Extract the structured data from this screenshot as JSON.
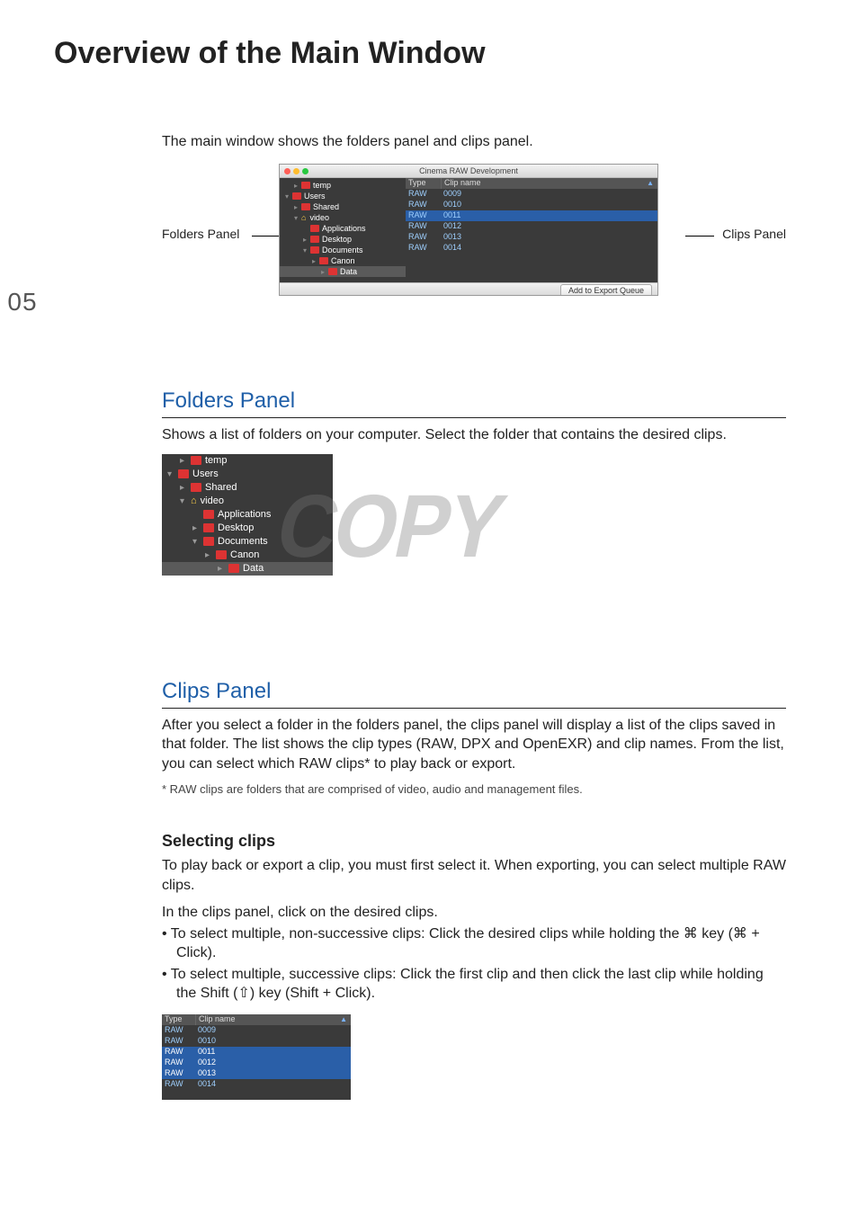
{
  "page_number": "05",
  "title": "Overview of the Main Window",
  "intro": "The main window shows the folders panel and clips panel.",
  "fig_main": {
    "left_label": "Folders Panel",
    "right_label": "Clips Panel",
    "window_title": "Cinema RAW Development",
    "export_button": "Add to Export Queue",
    "folders": [
      {
        "indent": 1,
        "arrow": "▸",
        "icon": "folder",
        "label": "temp"
      },
      {
        "indent": 0,
        "arrow": "▾",
        "icon": "folder",
        "label": "Users"
      },
      {
        "indent": 1,
        "arrow": "▸",
        "icon": "folder",
        "label": "Shared"
      },
      {
        "indent": 1,
        "arrow": "▾",
        "icon": "home",
        "label": "video"
      },
      {
        "indent": 2,
        "arrow": "",
        "icon": "folder",
        "label": "Applications"
      },
      {
        "indent": 2,
        "arrow": "▸",
        "icon": "folder",
        "label": "Desktop"
      },
      {
        "indent": 2,
        "arrow": "▾",
        "icon": "folder",
        "label": "Documents"
      },
      {
        "indent": 3,
        "arrow": "▸",
        "icon": "folder",
        "label": "Canon"
      },
      {
        "indent": 4,
        "arrow": "▸",
        "icon": "folder",
        "label": "Data",
        "selected": true
      }
    ],
    "clip_headers": {
      "type": "Type",
      "name": "Clip name"
    },
    "clips": [
      {
        "type": "RAW",
        "name": "0009"
      },
      {
        "type": "RAW",
        "name": "0010"
      },
      {
        "type": "RAW",
        "name": "0011",
        "selected": true
      },
      {
        "type": "RAW",
        "name": "0012"
      },
      {
        "type": "RAW",
        "name": "0013"
      },
      {
        "type": "RAW",
        "name": "0014"
      }
    ]
  },
  "sections": {
    "folders": {
      "heading": "Folders Panel",
      "body": "Shows a list of folders on your computer. Select the folder that contains the desired clips."
    },
    "clips": {
      "heading": "Clips Panel",
      "body": "After you select a folder in the folders panel, the clips panel will display a list of the clips saved in that folder. The list shows the clip types (RAW, DPX and OpenEXR) and clip names. From the list, you can select which RAW clips* to play back or export.",
      "footnote": "* RAW clips are folders that are comprised of video, audio and management files."
    }
  },
  "watermark": "COPY",
  "selecting": {
    "heading": "Selecting clips",
    "body": "To play back or export a clip, you must first select it. When exporting, you can select multiple RAW clips.",
    "lead": "In the clips panel, click on the desired clips.",
    "bullets": [
      "To select multiple, non-successive clips: Click the desired clips while holding the ⌘ key (⌘ + Click).",
      "To select multiple, successive clips: Click the first clip and then click the last clip while holding the Shift (⇧) key (Shift + Click)."
    ]
  },
  "fig_clips_small": {
    "headers": {
      "type": "Type",
      "name": "Clip name"
    },
    "rows": [
      {
        "type": "RAW",
        "name": "0009"
      },
      {
        "type": "RAW",
        "name": "0010"
      },
      {
        "type": "RAW",
        "name": "0011",
        "selected": true
      },
      {
        "type": "RAW",
        "name": "0012",
        "selected": true
      },
      {
        "type": "RAW",
        "name": "0013",
        "selected": true
      },
      {
        "type": "RAW",
        "name": "0014"
      }
    ]
  }
}
